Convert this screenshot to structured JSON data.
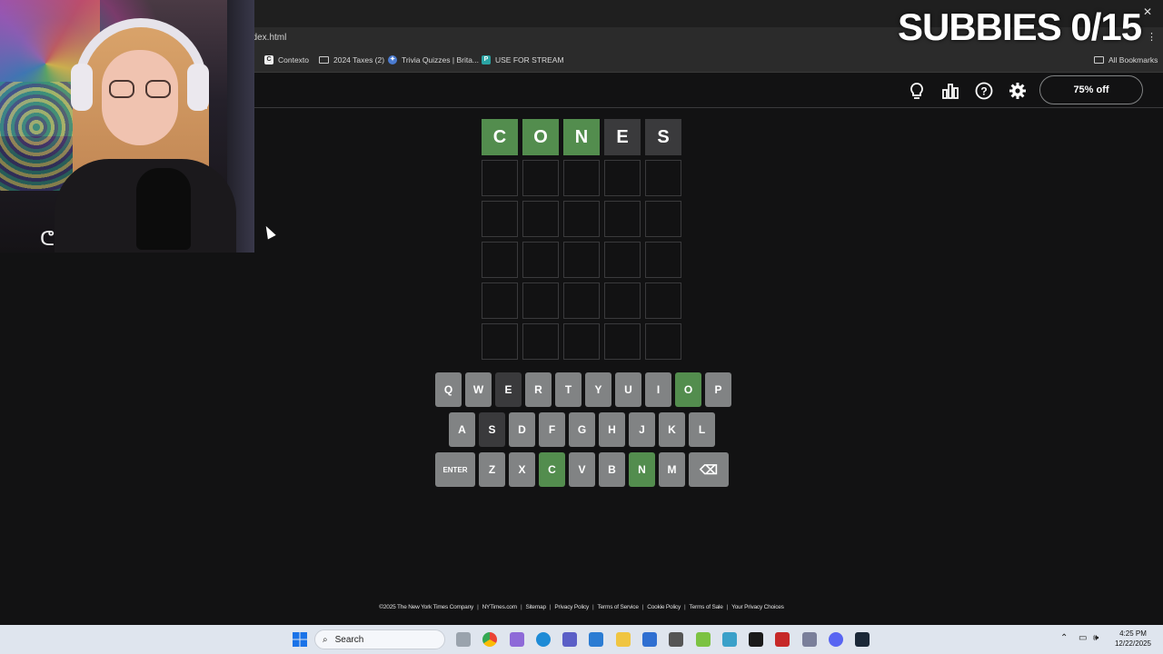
{
  "browser": {
    "url": "ndex.html",
    "bookmarks": [
      "Contexto",
      "2024 Taxes (2)",
      "Trivia Quizzes | Brita...",
      "USE FOR STREAM"
    ],
    "all_bookmarks": "All Bookmarks"
  },
  "header": {
    "promo": "75% off",
    "icons": [
      "lightbulb-icon",
      "stats-icon",
      "help-icon",
      "settings-icon"
    ]
  },
  "board": {
    "rows": [
      [
        {
          "l": "C",
          "s": "correct"
        },
        {
          "l": "O",
          "s": "correct"
        },
        {
          "l": "N",
          "s": "correct"
        },
        {
          "l": "E",
          "s": "absent"
        },
        {
          "l": "S",
          "s": "absent"
        }
      ],
      [
        {
          "l": "",
          "s": "empty"
        },
        {
          "l": "",
          "s": "empty"
        },
        {
          "l": "",
          "s": "empty"
        },
        {
          "l": "",
          "s": "empty"
        },
        {
          "l": "",
          "s": "empty"
        }
      ],
      [
        {
          "l": "",
          "s": "empty"
        },
        {
          "l": "",
          "s": "empty"
        },
        {
          "l": "",
          "s": "empty"
        },
        {
          "l": "",
          "s": "empty"
        },
        {
          "l": "",
          "s": "empty"
        }
      ],
      [
        {
          "l": "",
          "s": "empty"
        },
        {
          "l": "",
          "s": "empty"
        },
        {
          "l": "",
          "s": "empty"
        },
        {
          "l": "",
          "s": "empty"
        },
        {
          "l": "",
          "s": "empty"
        }
      ],
      [
        {
          "l": "",
          "s": "empty"
        },
        {
          "l": "",
          "s": "empty"
        },
        {
          "l": "",
          "s": "empty"
        },
        {
          "l": "",
          "s": "empty"
        },
        {
          "l": "",
          "s": "empty"
        }
      ],
      [
        {
          "l": "",
          "s": "empty"
        },
        {
          "l": "",
          "s": "empty"
        },
        {
          "l": "",
          "s": "empty"
        },
        {
          "l": "",
          "s": "empty"
        },
        {
          "l": "",
          "s": "empty"
        }
      ]
    ]
  },
  "keyboard": {
    "rows": [
      [
        {
          "k": "Q"
        },
        {
          "k": "W"
        },
        {
          "k": "E",
          "s": "absent"
        },
        {
          "k": "R"
        },
        {
          "k": "T"
        },
        {
          "k": "Y"
        },
        {
          "k": "U"
        },
        {
          "k": "I"
        },
        {
          "k": "O",
          "s": "correct"
        },
        {
          "k": "P"
        }
      ],
      [
        {
          "k": "A"
        },
        {
          "k": "S",
          "s": "absent"
        },
        {
          "k": "D"
        },
        {
          "k": "F"
        },
        {
          "k": "G"
        },
        {
          "k": "H"
        },
        {
          "k": "J"
        },
        {
          "k": "K"
        },
        {
          "k": "L"
        }
      ],
      [
        {
          "k": "ENTER",
          "wide": true
        },
        {
          "k": "Z"
        },
        {
          "k": "X"
        },
        {
          "k": "C",
          "s": "correct"
        },
        {
          "k": "V"
        },
        {
          "k": "B"
        },
        {
          "k": "N",
          "s": "correct"
        },
        {
          "k": "M"
        },
        {
          "k": "⌫",
          "wide": true
        }
      ]
    ]
  },
  "footer": {
    "links": [
      "©2025 The New York Times Company",
      "NYTimes.com",
      "Sitemap",
      "Privacy Policy",
      "Terms of Service",
      "Cookie Policy",
      "Terms of Sale",
      "Your Privacy Choices"
    ]
  },
  "overlay": {
    "subs": "SUBBIES 0/15"
  },
  "taskbar": {
    "search": "Search",
    "time": "4:25 PM",
    "date": "12/22/2025"
  },
  "colors": {
    "correct": "#538d4e",
    "absent": "#3a3a3c",
    "key": "#818384",
    "bg": "#121213"
  }
}
